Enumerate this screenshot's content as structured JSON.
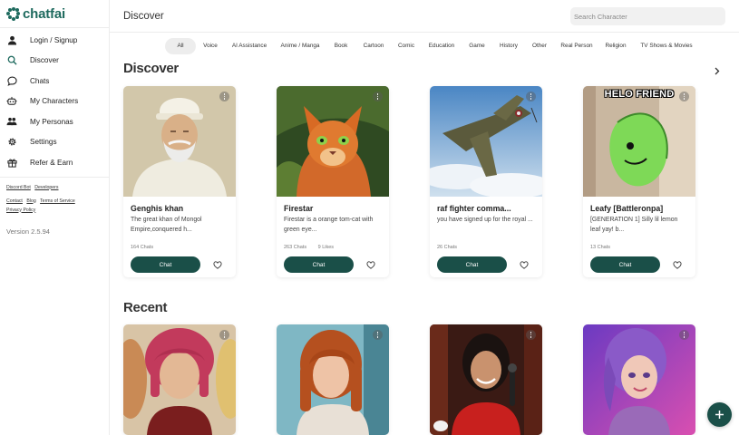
{
  "app": {
    "logo_text": "chatfai",
    "brand_color": "#1e6a5e",
    "button_color": "#1a4f48"
  },
  "sidebar": {
    "items": [
      {
        "label": "Login / Signup",
        "icon": "user-icon"
      },
      {
        "label": "Discover",
        "icon": "search-icon"
      },
      {
        "label": "Chats",
        "icon": "chat-bubble-icon"
      },
      {
        "label": "My Characters",
        "icon": "robot-icon"
      },
      {
        "label": "My Personas",
        "icon": "people-icon"
      },
      {
        "label": "Settings",
        "icon": "gear-icon"
      },
      {
        "label": "Refer & Earn",
        "icon": "gift-icon"
      }
    ],
    "links": [
      "Discord Bot",
      "Developers",
      "Contact",
      "Blog",
      "Terms of Service",
      "Privacy Policy"
    ],
    "version": "Version 2.5.94"
  },
  "header": {
    "title": "Discover",
    "search_placeholder": "Search Character"
  },
  "categories": {
    "active": "All",
    "items": [
      "All",
      "Voice",
      "AI Assistance",
      "Anime / Manga",
      "Book",
      "Cartoon",
      "Comic",
      "Education",
      "Game",
      "History",
      "Other",
      "Real Person",
      "Religion",
      "TV Shows & Movies"
    ]
  },
  "discover": {
    "title": "Discover",
    "cards": [
      {
        "name": "Genghis khan",
        "desc": "The great khan of Mongol Empire,conquered h...",
        "chats": "164 Chats",
        "likes": "",
        "chat_label": "Chat"
      },
      {
        "name": "Firestar",
        "desc": "Firestar is a orange tom-cat with green eye...",
        "chats": "263 Chats",
        "likes": "9 Likes",
        "chat_label": "Chat"
      },
      {
        "name": "raf fighter comma...",
        "desc": "you have signed up for the royal ...",
        "chats": "26 Chats",
        "likes": "",
        "chat_label": "Chat"
      },
      {
        "name": "Leafy [Battleronpa]",
        "desc": "[GENERATION 1] Silly lil lemon leaf yay! b...",
        "chats": "13 Chats",
        "likes": "",
        "chat_label": "Chat",
        "image_caption": "HELO FRIEND"
      }
    ]
  },
  "recent": {
    "title": "Recent"
  }
}
